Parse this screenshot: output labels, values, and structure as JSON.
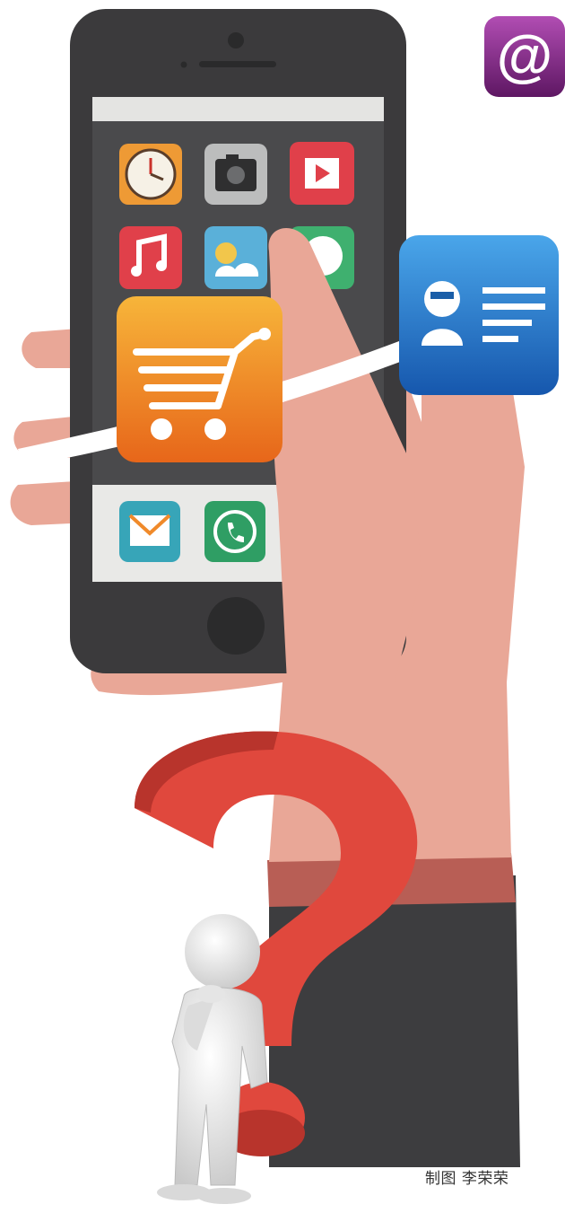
{
  "credit": "制图 李荣荣",
  "colors": {
    "skin": "#e9a797",
    "phone_body": "#3b3a3c",
    "phone_screen": "#4a4a4c",
    "sleeve": "#3d3d3f",
    "cuff": "#b85e55",
    "question_mark": "#e0483d",
    "cart_orange": "#ef7a1c",
    "contact_blue": "#1c6fc4",
    "at_purple": "#8a2a8f"
  },
  "icons": [
    "clock-icon",
    "camera-icon",
    "video-play-icon",
    "music-note-icon",
    "weather-icon",
    "chat-bubble-icon",
    "mail-icon",
    "phone-call-icon",
    "shopping-cart-icon",
    "contact-card-icon",
    "at-sign-icon"
  ]
}
